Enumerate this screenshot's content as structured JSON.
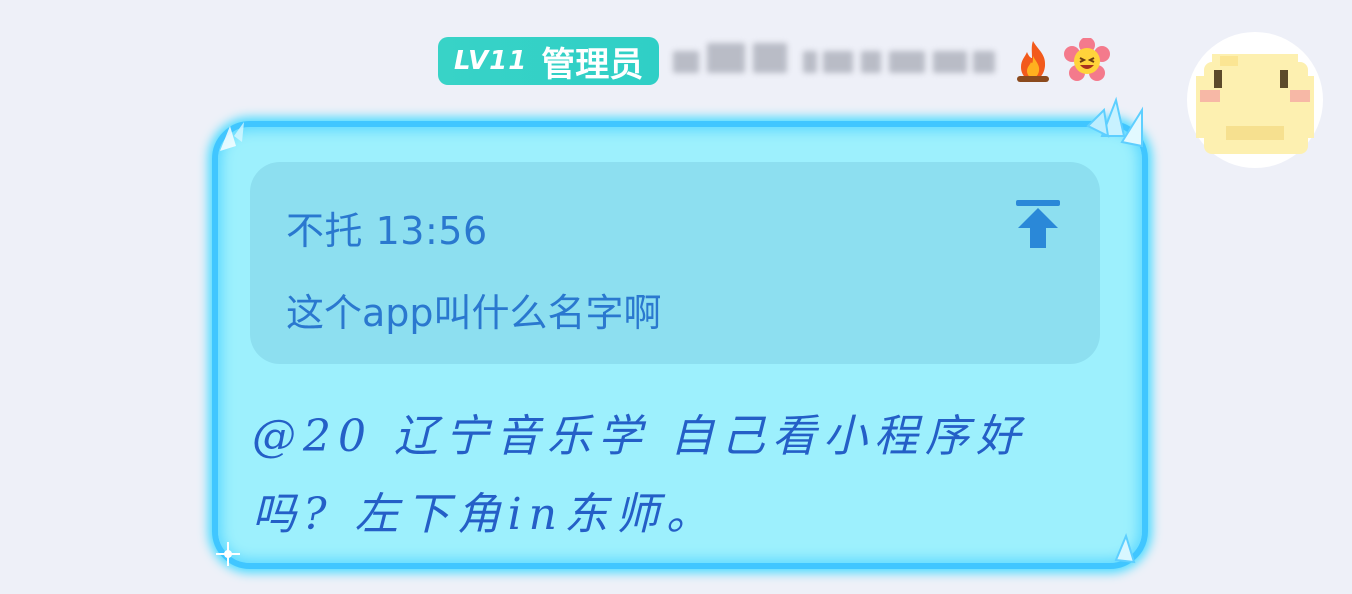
{
  "sender": {
    "level": "LV11",
    "role": "管理员",
    "icons": [
      "fire-icon",
      "laughing-flower-icon"
    ]
  },
  "quote": {
    "author": "不托",
    "time": "13:56",
    "text": "这个app叫什么名字啊",
    "action_icon": "jump-to-top-icon"
  },
  "message": {
    "line1": "@20 辽宁音乐学 自己看小程序好",
    "line2": "吗? 左下角in东师。"
  },
  "colors": {
    "bubble_fill": "#9df0fd",
    "bubble_glow": "#40c6ff",
    "quote_fill": "#8ddff0",
    "quote_text": "#2a78cf",
    "message_text": "#245fc7",
    "badge": "#38d3c7"
  }
}
